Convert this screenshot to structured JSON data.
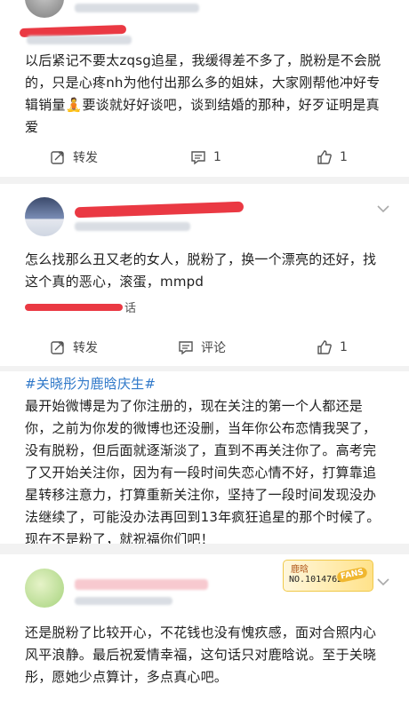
{
  "post1": {
    "meta_faint": "来自 安卓手机",
    "source_faint": "安卓超话",
    "text": "以后紧记不要太zqsg追星，我缓得差不多了，脱粉是不会脱的，只是心疼nh为他付出那么多的姐妹，大家刚帮他冲好专辑销量🧘要谈就好好谈吧，谈到结婚的那种，好歹证明是真爱",
    "actions": {
      "repost": "转发",
      "comment_count": "1",
      "like_count": "1"
    }
  },
  "post2": {
    "meta_faint": "来自 安卓手机",
    "text": "怎么找那么丑又老的女人，脱粉了，换一个漂亮的还好，找这个真的恶心，滚蛋，mmpd",
    "source_suffix": "话",
    "actions": {
      "repost": "转发",
      "comment": "评论",
      "like_count": "1"
    }
  },
  "post3": {
    "hashtag": "#关晓彤为鹿晗庆生#",
    "text": "最开始微博是为了你注册的，现在关注的第一个人都还是你，之前为你发的微博也还没删，当年你公布恋情我哭了，没有脱粉，但后面就逐渐淡了，直到不再关注你了。高考完了又开始关注你，因为有一段时间失恋心情不好，打算靠追星转移注意力，打算重新关注你，坚持了一段时间发现没办法继续了，可能没办法再回到13年疯狂追星的那个时候了。现在不是粉了，就祝福你们吧！"
  },
  "post4": {
    "badge": {
      "name": "鹿晗",
      "number": "NO.1014762",
      "fans": "FANS"
    },
    "text": "还是脱粉了比较开心，不花钱也没有愧疚感，面对合照内心风平浪静。最后祝爱情幸福，这句话只对鹿晗说。至于关晓彤，愿她少点算计，多点真心吧。"
  },
  "colors": {
    "redaction": "#e8232f",
    "hashtag": "#2f78c9",
    "badge_gold": "#f0b72f"
  }
}
